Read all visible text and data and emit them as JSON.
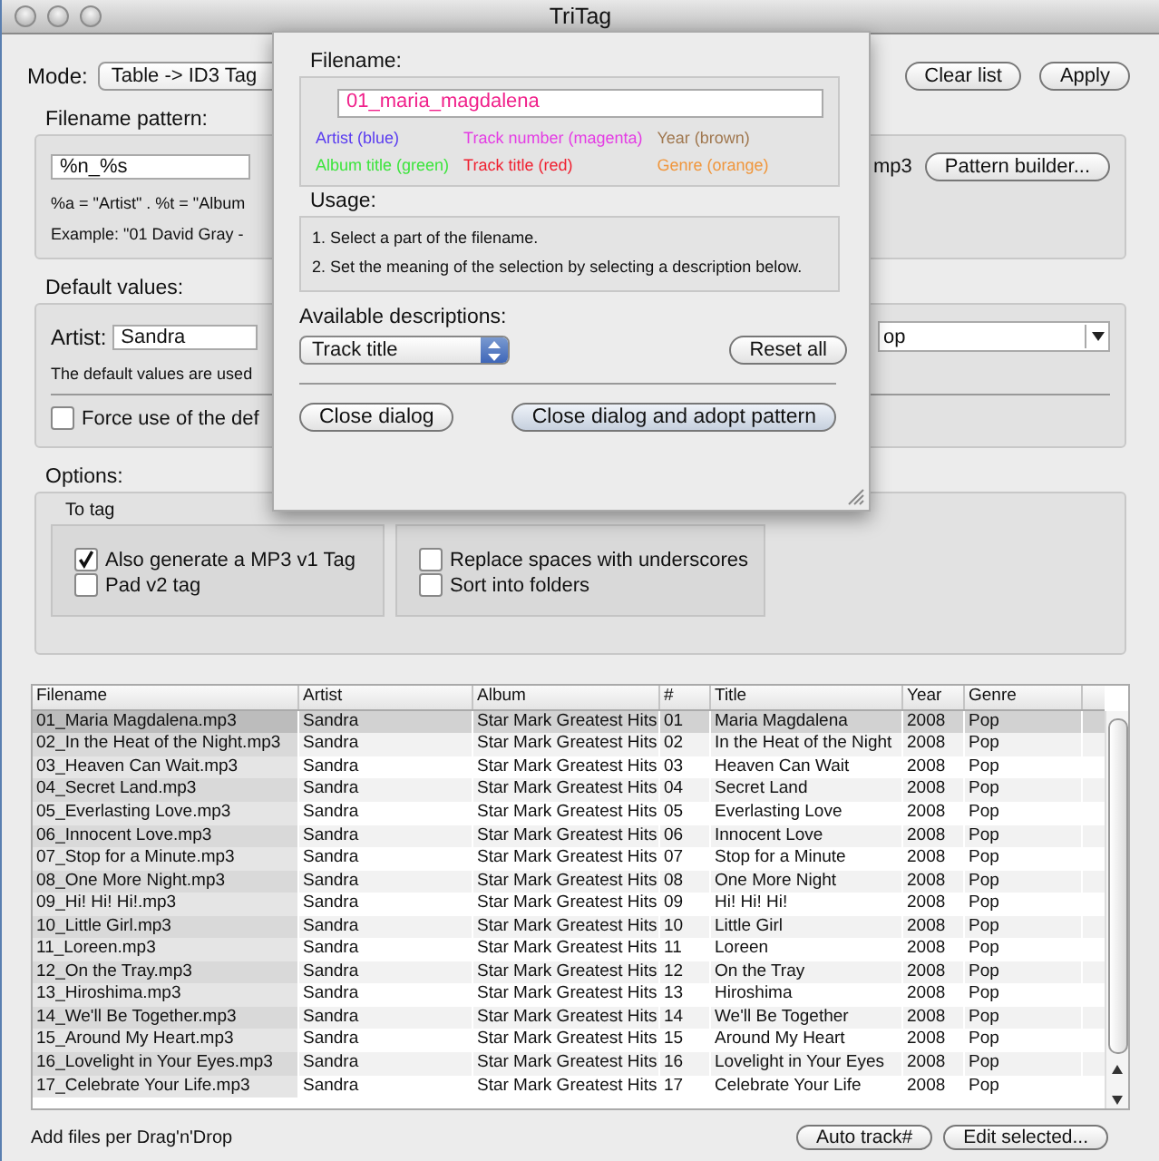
{
  "window": {
    "title": "TriTag"
  },
  "mode": {
    "label": "Mode:",
    "value": "Table -> ID3 Tag"
  },
  "toolbar_buttons": [
    "Clear list",
    "Apply"
  ],
  "filename_pattern": {
    "label": "Filename pattern:",
    "value": "%n_%s",
    "extension": "mp3",
    "button": "Pattern builder...",
    "help": [
      "%a = \"Artist\" . %t = \"Album",
      "Example: \"01 David Gray -"
    ]
  },
  "default_values": {
    "label": "Default values:",
    "artist_label": "Artist:",
    "artist_value": "Sandra",
    "genre_value": "op",
    "note": "The default values are used",
    "force": {
      "label": "Force use of the def",
      "checked": false
    }
  },
  "options": {
    "label": "Options:",
    "to_tag": {
      "label": "To tag",
      "items": [
        {
          "label": "Also generate a MP3 v1 Tag",
          "checked": true
        },
        {
          "label": "Pad v2 tag",
          "checked": false
        }
      ]
    },
    "to_filename": {
      "items": [
        {
          "label": "Replace spaces with underscores",
          "checked": false
        },
        {
          "label": "Sort into folders",
          "checked": false
        }
      ]
    }
  },
  "table": {
    "columns": [
      "Filename",
      "Artist",
      "Album",
      "#",
      "Title",
      "Year",
      "Genre"
    ],
    "rows": [
      {
        "cells": [
          "01_Maria Magdalena.mp3",
          "Sandra",
          "Star Mark Greatest Hits",
          "01",
          "Maria Magdalena",
          "2008",
          "Pop"
        ],
        "selected": true
      },
      {
        "cells": [
          "02_In the Heat of the Night.mp3",
          "Sandra",
          "Star Mark Greatest Hits",
          "02",
          "In the Heat of the Night",
          "2008",
          "Pop"
        ],
        "selected": false
      },
      {
        "cells": [
          "03_Heaven Can Wait.mp3",
          "Sandra",
          "Star Mark Greatest Hits",
          "03",
          "Heaven Can Wait",
          "2008",
          "Pop"
        ],
        "selected": false
      },
      {
        "cells": [
          "04_Secret Land.mp3",
          "Sandra",
          "Star Mark Greatest Hits",
          "04",
          "Secret Land",
          "2008",
          "Pop"
        ],
        "selected": false
      },
      {
        "cells": [
          "05_Everlasting Love.mp3",
          "Sandra",
          "Star Mark Greatest Hits",
          "05",
          "Everlasting Love",
          "2008",
          "Pop"
        ],
        "selected": false
      },
      {
        "cells": [
          "06_Innocent Love.mp3",
          "Sandra",
          "Star Mark Greatest Hits",
          "06",
          "Innocent Love",
          "2008",
          "Pop"
        ],
        "selected": false
      },
      {
        "cells": [
          "07_Stop for a Minute.mp3",
          "Sandra",
          "Star Mark Greatest Hits",
          "07",
          "Stop for a Minute",
          "2008",
          "Pop"
        ],
        "selected": false
      },
      {
        "cells": [
          "08_One More Night.mp3",
          "Sandra",
          "Star Mark Greatest Hits",
          "08",
          "One More Night",
          "2008",
          "Pop"
        ],
        "selected": false
      },
      {
        "cells": [
          "09_Hi! Hi! Hi!.mp3",
          "Sandra",
          "Star Mark Greatest Hits",
          "09",
          "Hi! Hi! Hi!",
          "2008",
          "Pop"
        ],
        "selected": false
      },
      {
        "cells": [
          "10_Little Girl.mp3",
          "Sandra",
          "Star Mark Greatest Hits",
          "10",
          "Little Girl",
          "2008",
          "Pop"
        ],
        "selected": false
      },
      {
        "cells": [
          "11_Loreen.mp3",
          "Sandra",
          "Star Mark Greatest Hits",
          "11",
          "Loreen",
          "2008",
          "Pop"
        ],
        "selected": false
      },
      {
        "cells": [
          "12_On the Tray.mp3",
          "Sandra",
          "Star Mark Greatest Hits",
          "12",
          "On the Tray",
          "2008",
          "Pop"
        ],
        "selected": false
      },
      {
        "cells": [
          "13_Hiroshima.mp3",
          "Sandra",
          "Star Mark Greatest Hits",
          "13",
          "Hiroshima",
          "2008",
          "Pop"
        ],
        "selected": false
      },
      {
        "cells": [
          "14_We'll Be Together.mp3",
          "Sandra",
          "Star Mark Greatest Hits",
          "14",
          "We'll Be Together",
          "2008",
          "Pop"
        ],
        "selected": false
      },
      {
        "cells": [
          "15_Around My Heart.mp3",
          "Sandra",
          "Star Mark Greatest Hits",
          "15",
          "Around My Heart",
          "2008",
          "Pop"
        ],
        "selected": false
      },
      {
        "cells": [
          "16_Lovelight in Your Eyes.mp3",
          "Sandra",
          "Star Mark Greatest Hits",
          "16",
          "Lovelight in Your Eyes",
          "2008",
          "Pop"
        ],
        "selected": false
      },
      {
        "cells": [
          "17_Celebrate Your Life.mp3",
          "Sandra",
          "Star Mark Greatest Hits",
          "17",
          "Celebrate Your Life",
          "2008",
          "Pop"
        ],
        "selected": false
      }
    ]
  },
  "status": "Add files per Drag'n'Drop",
  "bottom_buttons": [
    "Auto track#",
    "Edit selected..."
  ],
  "dialog": {
    "filename_label": "Filename:",
    "filename": "01_maria_magdalena",
    "legend": [
      {
        "label": "Artist (blue)",
        "color": "#5a3cf0"
      },
      {
        "label": "Track number (magenta)",
        "color": "#e43ce4"
      },
      {
        "label": "Year (brown)",
        "color": "#a07850"
      },
      {
        "label": "Album title (green)",
        "color": "#3ce43c"
      },
      {
        "label": "Track title (red)",
        "color": "#f02030"
      },
      {
        "label": "Genre (orange)",
        "color": "#f0963c"
      }
    ],
    "usage_label": "Usage:",
    "usage": [
      "1. Select a part of the filename.",
      "2. Set the meaning of the selection by selecting a description below."
    ],
    "descriptions_label": "Available descriptions:",
    "description": "Track title",
    "reset": "Reset all",
    "buttons": [
      "Close dialog",
      "Close dialog and adopt pattern"
    ]
  }
}
